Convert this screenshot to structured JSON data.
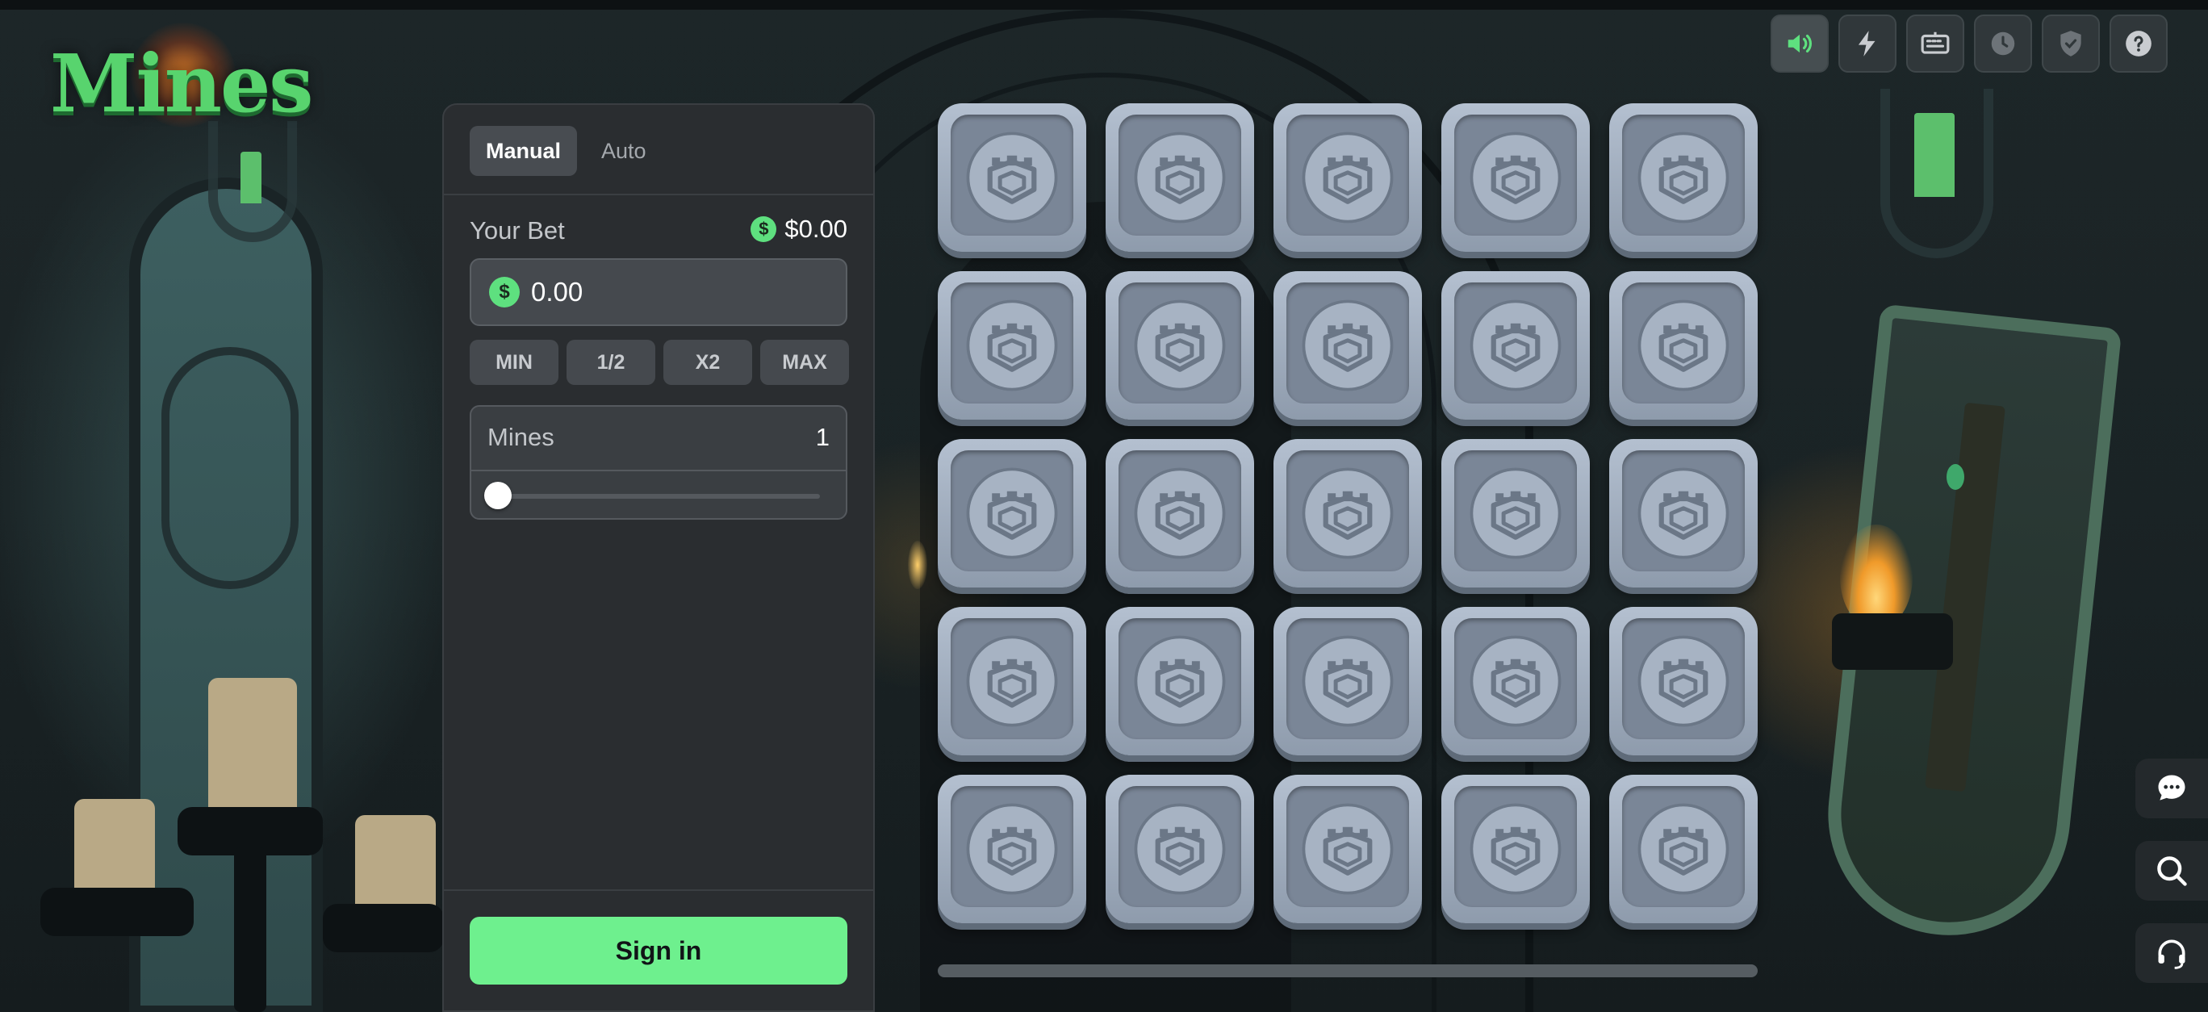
{
  "logo": {
    "text": "Mines"
  },
  "top_controls": [
    {
      "name": "sound-icon",
      "active": true
    },
    {
      "name": "lightning-icon",
      "active": false
    },
    {
      "name": "keyboard-icon",
      "active": false
    },
    {
      "name": "history-clock-icon",
      "active": false
    },
    {
      "name": "provably-fair-shield-icon",
      "active": false
    },
    {
      "name": "help-icon",
      "active": false
    }
  ],
  "side_controls": [
    {
      "name": "chat-icon"
    },
    {
      "name": "search-icon"
    },
    {
      "name": "support-headset-icon"
    }
  ],
  "panel": {
    "tabs": [
      {
        "label": "Manual",
        "active": true
      },
      {
        "label": "Auto",
        "active": false
      }
    ],
    "bet_label": "Your Bet",
    "currency_symbol": "$",
    "balance": "$0.00",
    "bet_value": "0.00",
    "quick_buttons": [
      "MIN",
      "1/2",
      "X2",
      "MAX"
    ],
    "mines_label": "Mines",
    "mines_value": "1",
    "mines_slider_level": 0,
    "sign_in_label": "Sign in"
  },
  "grid": {
    "rows": 5,
    "columns": 5,
    "tile_state": "hidden",
    "tile_icon": "tower-shield-icon"
  },
  "colors": {
    "accent": "#6ef08e",
    "coin": "#5ee07f",
    "panel": "#2a2d30",
    "tile": "#a3afbf"
  }
}
